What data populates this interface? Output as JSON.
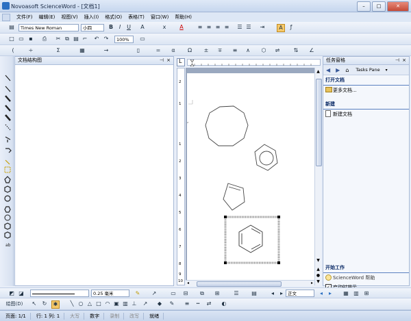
{
  "window": {
    "title": "Novoasoft ScienceWord - [文档1]"
  },
  "menu": [
    "文件(F)",
    "编辑(E)",
    "视图(V)",
    "插入(I)",
    "格式(O)",
    "表格(T)",
    "窗口(W)",
    "帮助(H)"
  ],
  "format_toolbar": {
    "font_name": "Times New Roman",
    "font_size": "小四"
  },
  "standard_toolbar": {
    "zoom": "100%"
  },
  "doc_structure_panel": {
    "title": "文档结构图"
  },
  "task_pane": {
    "title": "任务窗格",
    "nav_label": "Tasks Pane",
    "open_section": "打开文档",
    "more_docs": "更多文档...",
    "new_section": "新建",
    "new_doc": "新建文档",
    "start_section": "开始工作",
    "help_link": "ScienceWord 帮助",
    "show_on_start": "启动时提示"
  },
  "drawing_toolbar": {
    "line_width": "0.25 毫米",
    "draw_label": "绘图(D)"
  },
  "style_box": "正文",
  "status": {
    "page": "页面: 1/1",
    "position": "行: 1 列: 1",
    "caps": "大写",
    "num": "数字",
    "rec": "录制",
    "ovr": "改写",
    "ready": "就绪"
  },
  "ruler": {
    "left_ticks": [
      "2",
      "1",
      "1",
      "2",
      "3",
      "4",
      "5",
      "6",
      "7",
      "8",
      "9",
      "10"
    ]
  }
}
